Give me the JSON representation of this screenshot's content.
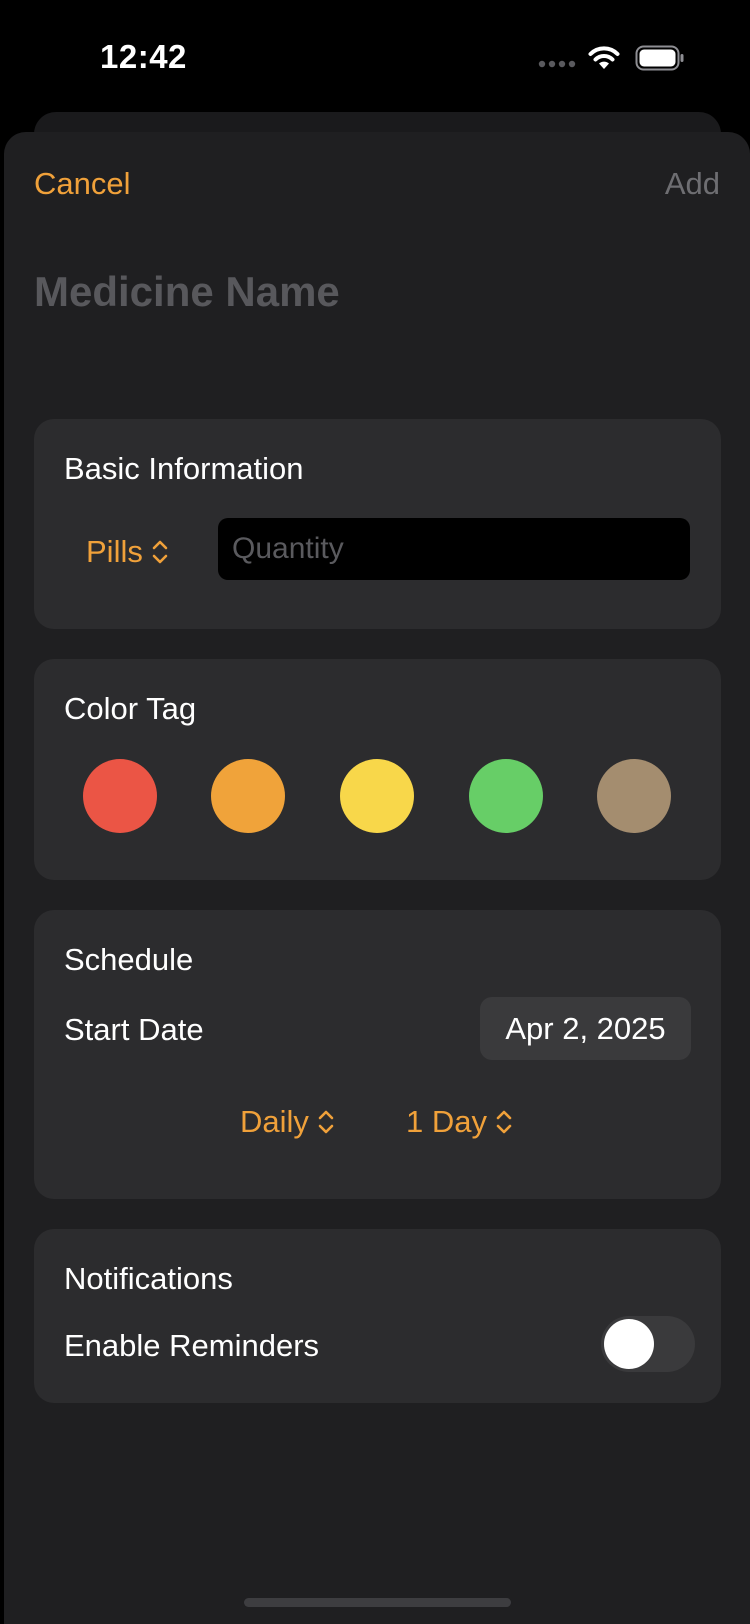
{
  "status_bar": {
    "time": "12:42"
  },
  "nav": {
    "cancel_label": "Cancel",
    "add_label": "Add"
  },
  "title_field": {
    "placeholder": "Medicine Name"
  },
  "basic_information": {
    "title": "Basic Information",
    "unit_picker": "Pills",
    "quantity_placeholder": "Quantity"
  },
  "color_tag": {
    "title": "Color Tag",
    "colors": [
      "#eb5545",
      "#f0a33a",
      "#f8d74a",
      "#67ce67",
      "#a48d6f"
    ]
  },
  "schedule": {
    "title": "Schedule",
    "start_date_label": "Start Date",
    "start_date_value": "Apr 2, 2025",
    "frequency": "Daily",
    "duration": "1 Day"
  },
  "notifications": {
    "title": "Notifications",
    "reminders_label": "Enable Reminders",
    "reminders_enabled": false
  },
  "colors": {
    "accent": "#f0a13a",
    "background": "#1f1f21",
    "card": "#2c2c2e"
  }
}
